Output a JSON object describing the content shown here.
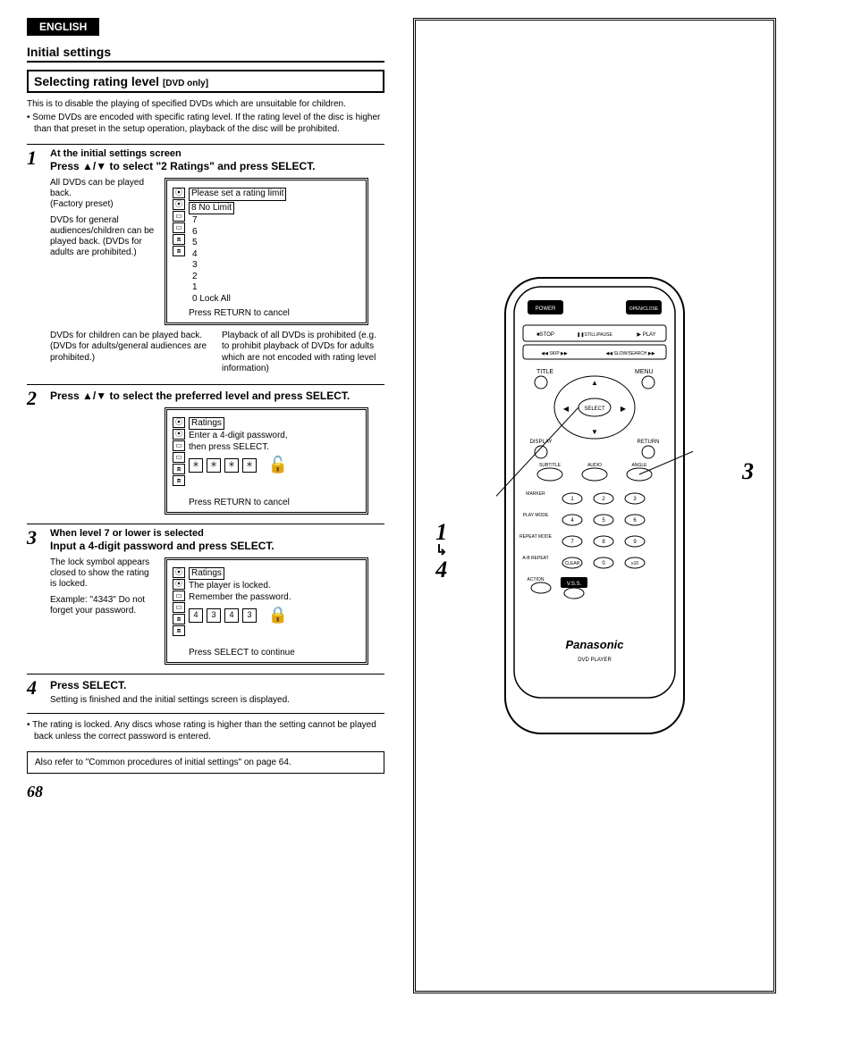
{
  "badge": "ENGLISH",
  "section_title": "Initial settings",
  "heading": {
    "main": "Selecting rating level",
    "sub": "[DVD only]"
  },
  "intro": "This is to disable the playing of specified DVDs which are unsuitable for children.",
  "intro_bullet": "• Some DVDs are encoded with specific rating level. If the rating level of the disc is higher than that preset in the setup operation, playback of the disc will be prohibited.",
  "steps": {
    "s1": {
      "num": "1",
      "lead": "At the initial settings screen",
      "sub": "Press ▲/▼ to select \"2 Ratings\" and press SELECT.",
      "left_desc1": "All DVDs can be played back.",
      "left_desc1b": "(Factory preset)",
      "left_desc2": "DVDs for general audiences/children can be played back. (DVDs for adults are prohibited.)",
      "screen_title": "Please set a rating limit",
      "screen_sel": "8 No Limit",
      "screen_levels": [
        "7",
        "6",
        "5",
        "4",
        "3",
        "2",
        "1",
        "0 Lock All"
      ],
      "screen_footer": "Press RETURN to cancel",
      "annot_left": "DVDs for children can be played back. (DVDs for adults/general audiences are prohibited.)",
      "annot_right": "Playback of all DVDs is prohibited (e.g. to prohibit playback of DVDs for adults which are not encoded with rating level information)"
    },
    "s2": {
      "num": "2",
      "sub": "Press ▲/▼ to select the preferred level and press SELECT.",
      "screen_title": "Ratings",
      "screen_line1": "Enter a 4-digit password,",
      "screen_line2": "then press SELECT.",
      "pw": [
        "＊",
        "＊",
        "＊",
        "＊"
      ],
      "lock_glyph": "🔓",
      "screen_footer": "Press RETURN to cancel"
    },
    "s3": {
      "num": "3",
      "lead": "When level 7 or lower is selected",
      "sub": "Input a 4-digit password and press SELECT.",
      "left_desc": "The lock symbol appears closed to show the rating is locked.",
      "left_desc2": "Example: \"4343\" Do not forget your password.",
      "screen_title": "Ratings",
      "screen_line1": "The player is locked.",
      "screen_line2": "Remember the password.",
      "pw": [
        "4",
        "3",
        "4",
        "3"
      ],
      "lock_glyph": "🔒",
      "screen_footer": "Press SELECT to continue"
    },
    "s4": {
      "num": "4",
      "sub": "Press SELECT.",
      "body": "Setting is finished and the initial settings screen is displayed."
    }
  },
  "note": "• The rating is locked. Any discs whose rating is higher than the setting cannot be played back unless the correct password is entered.",
  "also": "Also refer to \"Common procedures of initial settings\" on page 64.",
  "page_num": "68",
  "remote": {
    "brand": "Panasonic",
    "model_label": "DVD PLAYER",
    "row_top": [
      "POWER",
      "OPEN/CLOSE"
    ],
    "row_play": [
      "■STOP",
      "❚❚STILL/PAUSE",
      "▶ PLAY"
    ],
    "row_skip": [
      "◀◀ SKIP ▶▶",
      "◀◀ SLOW/SEARCH ▶▶"
    ],
    "row_menu": [
      "TITLE",
      "MENU"
    ],
    "center": "SELECT",
    "row_disp": [
      "DISPLAY",
      "RETURN"
    ],
    "row_sub": [
      "SUBTITLE",
      "AUDIO",
      "ANGLE"
    ],
    "keypad": [
      [
        "MARKER",
        "1",
        "2",
        "3"
      ],
      [
        "PLAY MODE",
        "4",
        "5",
        "6"
      ],
      [
        "REPEAT MODE",
        "7",
        "8",
        "9"
      ],
      [
        "A-B REPEAT",
        "CLEAR",
        "0",
        "≥10"
      ],
      [
        "ACTION",
        "V.S.S.",
        "",
        ""
      ]
    ]
  },
  "callouts": {
    "left_top": "1",
    "left_arrow": "↳",
    "left_bottom": "4",
    "right": "3"
  }
}
